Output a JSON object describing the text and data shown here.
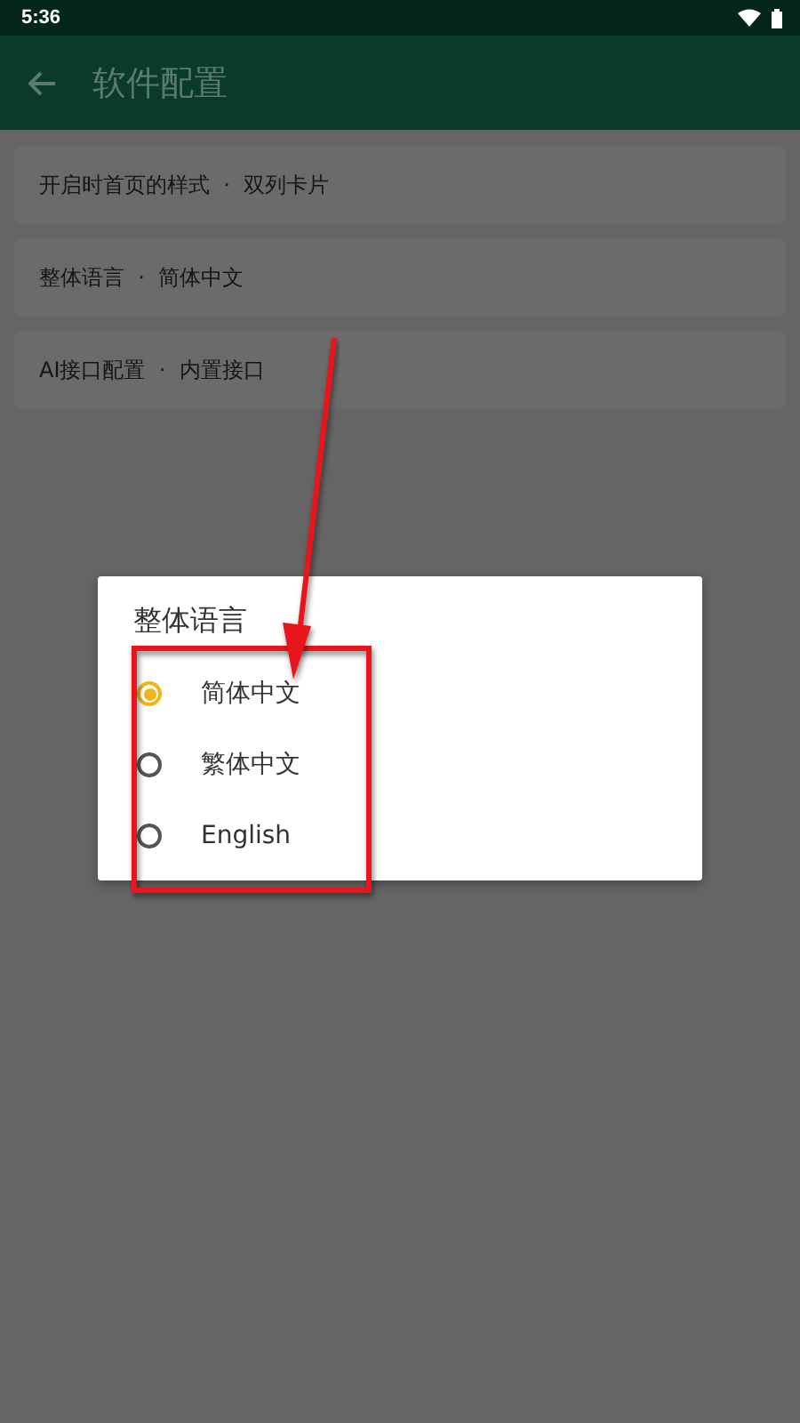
{
  "status_bar": {
    "time": "5:36"
  },
  "app_bar": {
    "title": "软件配置"
  },
  "settings": [
    {
      "label": "开启时首页的样式",
      "separator": "·",
      "value": "双列卡片"
    },
    {
      "label": "整体语言",
      "separator": "·",
      "value": "简体中文"
    },
    {
      "label": "AI接口配置",
      "separator": "·",
      "value": "内置接口"
    }
  ],
  "dialog": {
    "title": "整体语言",
    "options": [
      {
        "label": "简体中文",
        "selected": true
      },
      {
        "label": "繁体中文",
        "selected": false
      },
      {
        "label": "English",
        "selected": false
      }
    ]
  }
}
